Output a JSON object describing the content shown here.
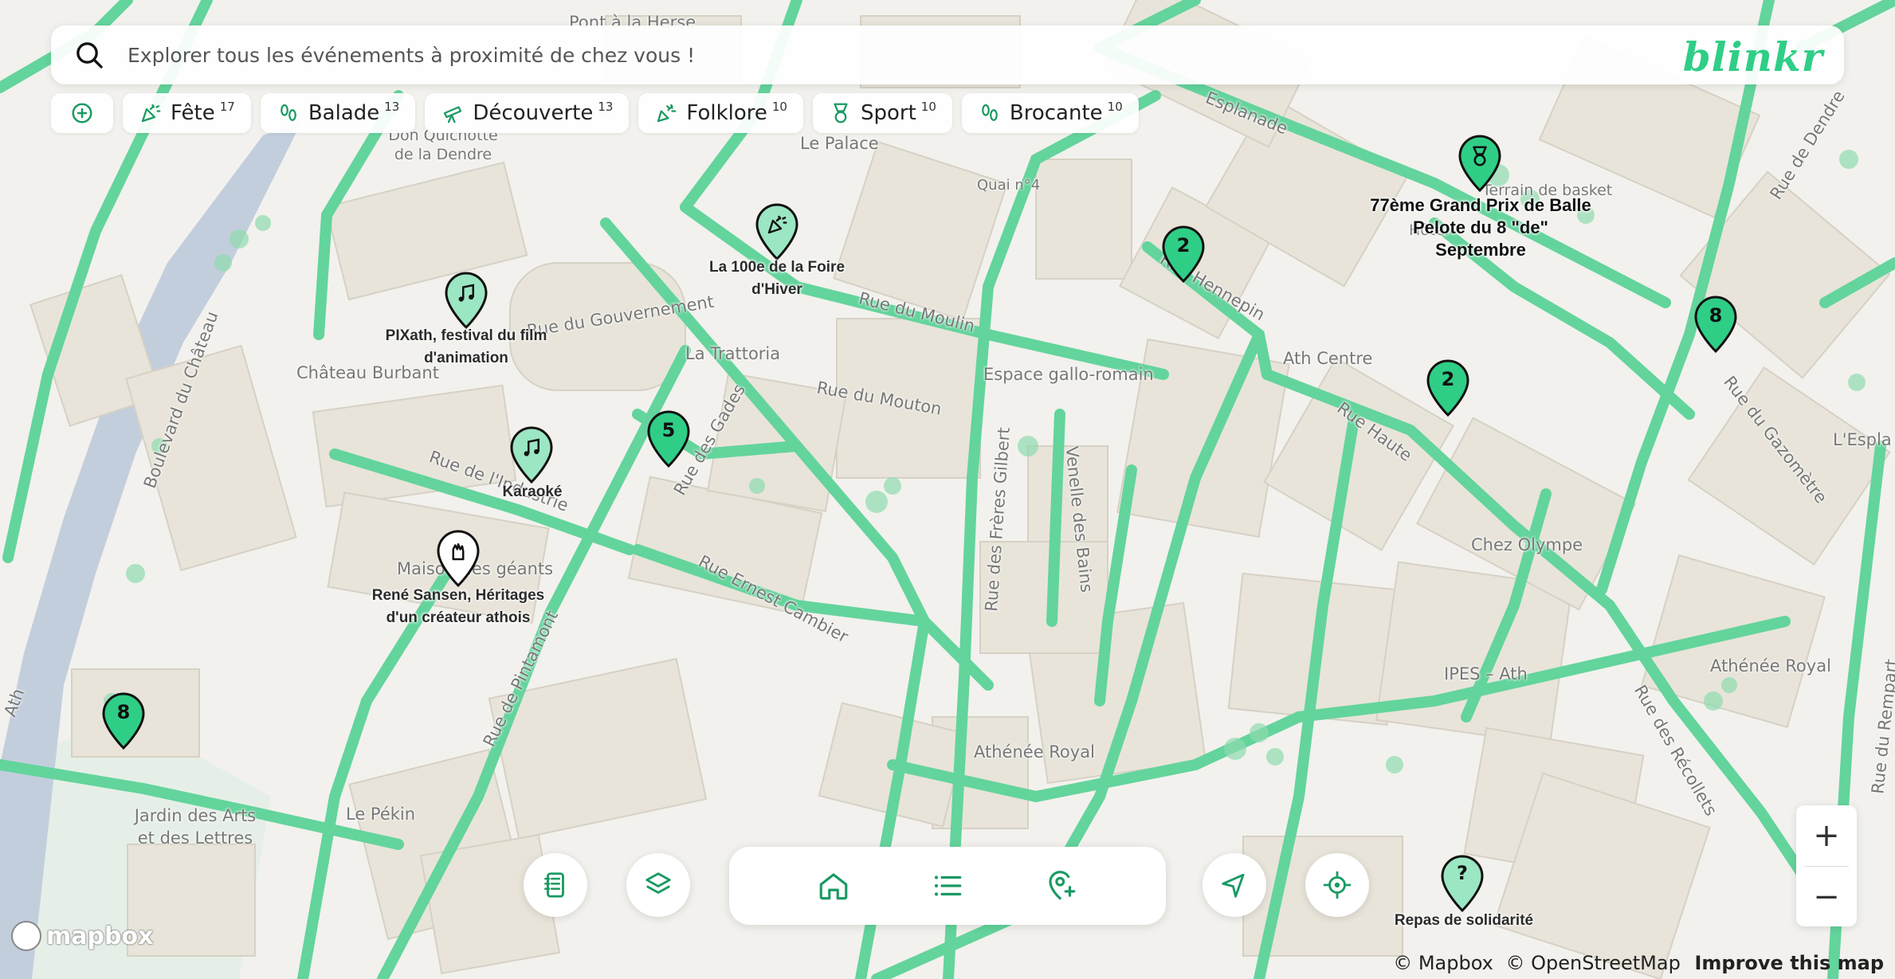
{
  "search": {
    "placeholder": "Explorer tous les événements à proximité de chez vous !"
  },
  "brand": "blinkr",
  "colors": {
    "accent": "#2fce86",
    "road": "#63d49c",
    "building": "#e9e5dc",
    "river": "#b9c7db"
  },
  "filters": [
    {
      "label": "Fête",
      "count": "17",
      "icon": "party-popper-icon"
    },
    {
      "label": "Balade",
      "count": "13",
      "icon": "footprints-icon"
    },
    {
      "label": "Découverte",
      "count": "13",
      "icon": "telescope-icon"
    },
    {
      "label": "Folklore",
      "count": "10",
      "icon": "confetti-icon"
    },
    {
      "label": "Sport",
      "count": "10",
      "icon": "medal-icon"
    },
    {
      "label": "Brocante",
      "count": "10",
      "icon": "footprints-icon"
    }
  ],
  "events": [
    {
      "label": "PIXath, festival du film d'animation",
      "icon": "music-icon"
    },
    {
      "label": "La 100e de la Foire d'Hiver",
      "icon": "party-popper-icon"
    },
    {
      "label": "Karaoké",
      "icon": "music-icon"
    },
    {
      "label": "René Sansen, Héritages d'un créateur athois",
      "icon": "glove-icon"
    },
    {
      "label": "77ème Grand Prix de Balle Pelote du 8 \"de\" Septembre",
      "icon": "medal-icon"
    },
    {
      "label": "Repas de solidarité",
      "icon": "question-icon"
    }
  ],
  "clusters": [
    {
      "count": "5"
    },
    {
      "count": "2"
    },
    {
      "count": "8"
    },
    {
      "count": "2"
    },
    {
      "count": "8"
    }
  ],
  "map_labels": [
    "Pont à la Herse",
    "Don Quichotte de la Dendre",
    "Le Palace",
    "Quai n°4",
    "Esplanade",
    "Terrain de basket",
    "Hôtel",
    "Rue du Gouvernement",
    "Château Burbant",
    "La Trattoria",
    "Rue du Moulin",
    "Rue Hennepin",
    "Ath Centre",
    "Espace gallo-romain",
    "Rue du Mouton",
    "Rue de l'Industrie",
    "Rue des Gades",
    "Rue Haute",
    "Rue du Gazomètre",
    "L'Espla",
    "Chez Olympe",
    "Maison des géants",
    "Rue Ernest Cambier",
    "Rue des Frères Gilbert",
    "Venelle des Bains",
    "Boulevard du Château",
    "IPES – Ath",
    "Athénée Royal",
    "Rue de Pintamont",
    "Athénée Royal",
    "Le Pékin",
    "Jardin des Arts et des Lettres",
    "Rue des Récollets",
    "Rue du Rempart",
    "Ath",
    "Rue de Dendre"
  ],
  "navbar": {
    "items": [
      "home-icon",
      "list-icon",
      "add-location-icon"
    ]
  },
  "controls": {
    "zoom_in": "+",
    "zoom_out": "−"
  },
  "attribution": {
    "mapbox": "© Mapbox",
    "osm": "© OpenStreetMap",
    "improve": "Improve this map"
  },
  "mapbox_logo": "mapbox"
}
